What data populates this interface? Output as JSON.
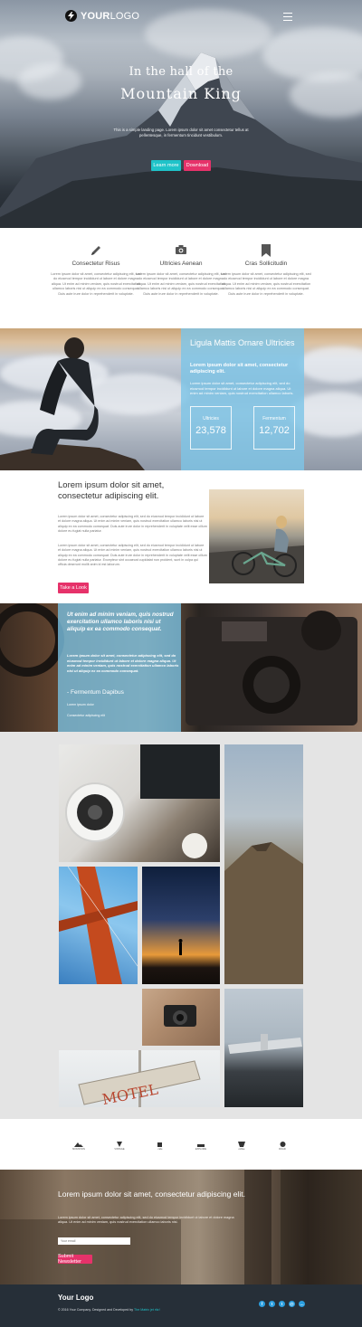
{
  "header": {
    "logo_bold": "YOUR",
    "logo_light": "LOGO"
  },
  "hero": {
    "title_line1": "In the hall of the",
    "title_line2": "Mountain King",
    "subtitle": "This is a simple landing page. Lorem ipsum dolor sit amet consectetur tellus at pellentesque, in fermentum tincidunt vestibulum.",
    "btn_primary": "Learn more",
    "btn_secondary": "Download"
  },
  "features": [
    {
      "icon": "pencil-icon",
      "title": "Consectetur Risus",
      "text": "Lorem ipsum dolor sit amet, consectetur adipiscing elit, sed do eiusmod tempor incididunt ut labore et dolore magna aliqua. Ut enim ad minim veniam, quis nostrud exercitation ullamco laboris nisi ut aliquip ex ea commodo consequat. Duis aute irure dolor in reprehenderit in voluptate."
    },
    {
      "icon": "camera-icon",
      "title": "Ultricies Aenean",
      "text": "Lorem ipsum dolor sit amet, consectetur adipiscing elit, sed do eiusmod tempor incididunt ut labore et dolore magna aliqua. Ut enim ad minim veniam, quis nostrud exercitation ullamco laboris nisi ut aliquip ex ea commodo consequat. Duis aute irure dolor in reprehenderit in voluptate."
    },
    {
      "icon": "bookmark-icon",
      "title": "Cras Sollicitudin",
      "text": "Lorem ipsum dolor sit amet, consectetur adipiscing elit, sed do eiusmod tempor incididunt ut labore et dolore magna aliqua. Ut enim ad minim veniam, quis nostrud exercitation ullamco laboris nisi ut aliquip ex ea commodo consequat. Duis aute irure dolor in reprehenderit in voluptate."
    }
  ],
  "cloud_section": {
    "title": "Ligula Mattis Ornare Ultricies",
    "subtitle": "Lorem ipsum dolor sit amet, consectetur adipiscing elit.",
    "body": "Lorem ipsum dolor sit amet, consectetur adipiscing elit, sed do eiusmod tempor incididunt ut labore et dolore magna aliqua. Ut enim ad minim veniam, quis nostrud exercitation ullamco laboris.",
    "stats": [
      {
        "label": "Ultricies",
        "value": "23,578"
      },
      {
        "label": "Fermentum",
        "value": "12,702"
      }
    ]
  },
  "intro": {
    "title": "Lorem ipsum dolor sit amet, consectetur adipiscing elit.",
    "para1": "Lorem ipsum dolor sit amet, consectetur adipiscing elit, sed do eiusmod tempor incididunt ut labore et dolore magna aliqua. Ut enim ad minim veniam, quis nostrud exercitation ullamco laboris nisi ut aliquip ex ea commodo consequat. Duis aute irure dolor in reprehenderit in voluptate velit esse cillum dolore eu fugiat nulla pariatur.",
    "para2": "Lorem ipsum dolor sit amet, consectetur adipiscing elit, sed do eiusmod tempor incididunt ut labore et dolore magna aliqua. Ut enim ad minim veniam, quis nostrud exercitation ullamco laboris nisi ut aliquip ex ea commodo consequat. Duis aute irure dolor in reprehenderit in voluptate velit esse cillum dolore eu fugiat nulla pariatur. Excepteur sint occaecat cupidatat non proident, sunt in culpa qui officia deserunt mollit anim id est laborum.",
    "button": "Take a Look"
  },
  "testimonial": {
    "quote": "Ut enim ad minim veniam, quis nostrud exercitation ullamco laboris nisi ut aliquip ex ea commodo consequat.",
    "body": "Lorem ipsum dolor sit amet, consectetur adipiscing elit, sed do eiusmod tempor incididunt ut labore et dolore magna aliqua. Ut enim ad minim veniam, quis nostrud exercitation ullamco laboris nisi ut aliquip ex ea commodo consequat.",
    "author": "- Fermentum Dapibus",
    "meta1": "Lorem ipsum dolor",
    "meta2": "Consectetur adipiscing elit"
  },
  "partners": [
    "MOUNTAIN",
    "VINTAGE",
    "cafe",
    "EXPLORE",
    "coffee",
    "ROAD"
  ],
  "newsletter": {
    "title": "Lorem ipsum dolor sit amet, consectetur adipiscing elit.",
    "body": "Lorem ipsum dolor sit amet, consectetur adipiscing elit, sed do eiusmod tempor incididunt ut labore et dolore magna aliqua. Ut enim ad minim veniam, quis nostrud exercitation ullamco laboris nisi.",
    "placeholder": "Your email",
    "button": "Submit Newsletter"
  },
  "footer": {
    "logo": "Your Logo",
    "copy": "© 2016 Your Company. Designed and Developed by",
    "credit": "The Matrix jet ritz!",
    "social": [
      "facebook-icon",
      "twitter-icon",
      "tumblr-icon",
      "email-icon",
      "chat-icon"
    ]
  },
  "colors": {
    "accent_teal": "#1fc3c9",
    "accent_pink": "#e6326a",
    "panel_blue": "#7ec4e6",
    "footer": "#262f38"
  }
}
